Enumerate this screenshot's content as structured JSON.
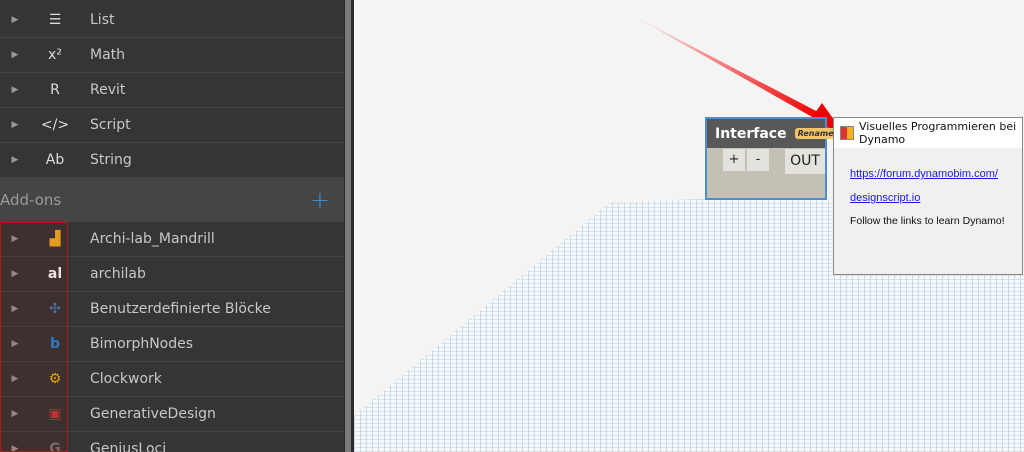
{
  "library": {
    "categories": [
      {
        "label": "List",
        "icon": "list-icon",
        "glyph": "☰"
      },
      {
        "label": "Math",
        "icon": "math-icon",
        "glyph": "x²"
      },
      {
        "label": "Revit",
        "icon": "revit-icon",
        "glyph": "R"
      },
      {
        "label": "Script",
        "icon": "script-icon",
        "glyph": "</>"
      },
      {
        "label": "String",
        "icon": "string-icon",
        "glyph": "Ab"
      }
    ],
    "addons_label": "Add-ons",
    "addons_add": "+",
    "addons": [
      {
        "label": "Archi-lab_Mandrill",
        "icon": "mandrill-icon",
        "glyph": "▟",
        "color": "#f0b020"
      },
      {
        "label": "archilab",
        "icon": "archilab-icon",
        "glyph": "al",
        "color": "#ffffff"
      },
      {
        "label": "Benutzerdefinierte Blöcke",
        "icon": "custom-node-icon",
        "glyph": "✣",
        "color": "#3f7fbf"
      },
      {
        "label": "BimorphNodes",
        "icon": "bimorph-icon",
        "glyph": "b",
        "color": "#1e88e5"
      },
      {
        "label": "Clockwork",
        "icon": "clockwork-icon",
        "glyph": "⚙",
        "color": "#f5b800"
      },
      {
        "label": "GenerativeDesign",
        "icon": "generative-design-icon",
        "glyph": "▣",
        "color": "#c0393b"
      },
      {
        "label": "GeniusLoci",
        "icon": "geniusloci-icon",
        "glyph": "G",
        "color": "#777777"
      }
    ]
  },
  "node": {
    "title": "Interface",
    "badge": "Renamed",
    "plus": "+",
    "minus": "-",
    "out": "OUT"
  },
  "dialog": {
    "title": "Visuelles Programmieren bei Dynamo",
    "link1": "https://forum.dynamobim.com/",
    "link2": "designscript.io",
    "text": "Follow the links to learn Dynamo!"
  }
}
